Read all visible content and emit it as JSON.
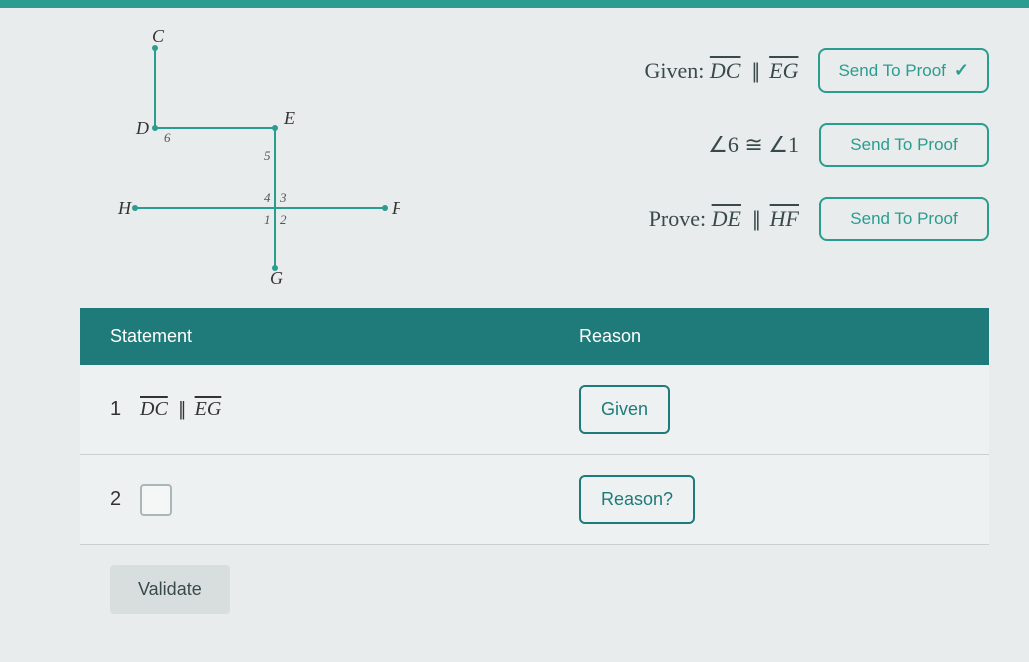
{
  "diagram": {
    "points": {
      "C": "C",
      "D": "D",
      "E": "E",
      "H": "H",
      "F": "F",
      "G": "G"
    },
    "angles": {
      "a1": "1",
      "a2": "2",
      "a3": "3",
      "a4": "4",
      "a5": "5",
      "a6": "6"
    }
  },
  "givens": {
    "row1": {
      "prefix": "Given:",
      "seg1": "DC",
      "sym": "||",
      "seg2": "EG",
      "btn": "Send To Proof",
      "checked": true
    },
    "row2": {
      "prefix": "",
      "ang1": "∠6",
      "sym": "≅",
      "ang2": "∠1",
      "btn": "Send To Proof",
      "checked": false
    },
    "row3": {
      "prefix": "Prove:",
      "seg1": "DE",
      "sym": "||",
      "seg2": "HF",
      "btn": "Send To Proof",
      "checked": false
    }
  },
  "table": {
    "headers": {
      "statement": "Statement",
      "reason": "Reason"
    },
    "rows": [
      {
        "num": "1",
        "stmt_seg1": "DC",
        "stmt_sym": "||",
        "stmt_seg2": "EG",
        "reason": "Given"
      },
      {
        "num": "2",
        "stmt_empty": true,
        "reason": "Reason?"
      }
    ]
  },
  "validate": "Validate"
}
